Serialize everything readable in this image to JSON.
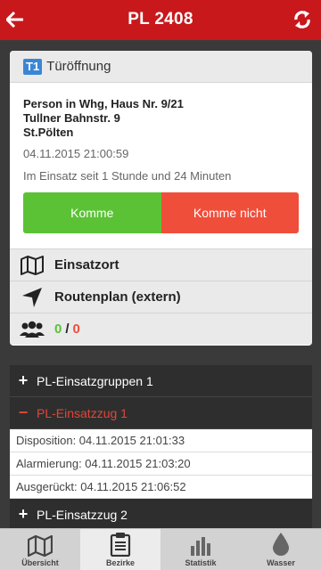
{
  "topbar": {
    "title": "PL 2408"
  },
  "incident": {
    "badge": "T1",
    "type": "Türöffnung",
    "address_line1": "Person in Whg, Haus Nr. 9/21",
    "address_line2": "Tullner Bahnstr. 9",
    "address_line3": "St.Pölten",
    "datetime": "04.11.2015 21:00:59",
    "duration": "Im Einsatz seit 1 Stunde und 24 Minuten",
    "btn_yes": "Komme",
    "btn_no": "Komme nicht",
    "location_label": "Einsatzort",
    "route_label": "Routenplan (extern)",
    "count_yes": "0",
    "count_sep": "/",
    "count_no": "0"
  },
  "groups": {
    "group1": "PL-Einsatzgruppen 1",
    "group2": "PL-Einsatzzug 1",
    "group2_items": [
      "Disposition: 04.11.2015 21:01:33",
      "Alarmierung: 04.11.2015 21:03:20",
      "Ausgerückt: 04.11.2015 21:06:52"
    ],
    "group3": "PL-Einsatzzug 2",
    "plus": "+",
    "minus": "−"
  },
  "tabs": [
    {
      "label": "Übersicht",
      "icon": "map-icon"
    },
    {
      "label": "Bezirke",
      "icon": "clipboard-icon"
    },
    {
      "label": "Statistik",
      "icon": "bar-chart-icon"
    },
    {
      "label": "Wasser",
      "icon": "water-drop-icon"
    }
  ],
  "colors": {
    "accent": "#c8181c",
    "yes": "#5bc236",
    "no": "#ef4e3b",
    "badge": "#3a86d6"
  }
}
